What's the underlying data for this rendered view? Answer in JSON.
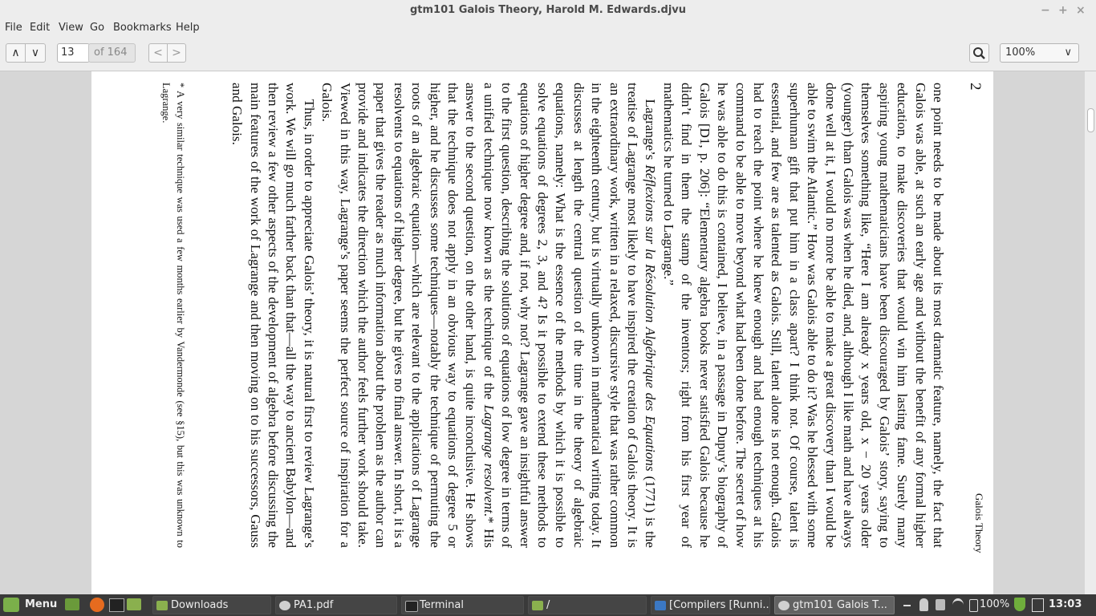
{
  "window": {
    "title": "gtm101  Galois Theory, Harold M. Edwards.djvu",
    "minimize": "−",
    "maximize": "+",
    "close": "×"
  },
  "menu": [
    "File",
    "Edit",
    "View",
    "Go",
    "Bookmarks",
    "Help"
  ],
  "toolbar": {
    "page_up": "∧",
    "page_down": "∨",
    "page_input": "13",
    "page_total": "of 164",
    "back": "<",
    "forward": ">",
    "search_icon": "search-icon",
    "zoom": "100%",
    "zoom_arrow": "∨"
  },
  "page": {
    "number": "2",
    "running_head": "Galois Theory",
    "p1": "one point needs to be made about its most dramatic feature, namely, the fact that Galois was able, at such an early age and without the benefit of any formal higher education, to make discoveries that would win him lasting fame. Surely many aspiring young mathematicians have been discouraged by Galois’ story, saying to themselves something like, “Here I am already x years old, x − 20 years older (younger) than Galois was when he died, and, although I like math and have always done well at it, I would no more be able to make a great discovery than I would be able to swim the Atlantic.” How was Galois able to do it? Was he blessed with some superhuman gift that put him in a class apart? I think not. Of course, talent is essential, and few are as talented as Galois. Still, talent alone is not enough. Galois had to reach the point where he knew enough and had enough techniques at his command to be able to move beyond what had been done before. The secret of how he was able to do this is contained, I believe, in a passage in Dupuy’s biography of Galois [D1, p. 206]: “Elementary algebra books never satisfied Galois because he didn’t find in them the stamp of the inventors; right from his first year of mathematics he turned to Lagrange.”",
    "p2_start": "Lagrange’s ",
    "p2_italic": "Réflexions sur la Résolution Algébrique des Equations",
    "p2_mid": " (1771) is the treatise of Lagrange most likely to have inspired the creation of Galois theory. It is an extraordinary work, written in a relaxed, discursive style that was rather common in the eighteenth century, but is virtually unknown in mathematical writing today. It discusses at length the central question of the time in the theory of algebraic equations, namely: What is the essence of the methods by which it is possible to solve equations of degrees 2, 3, and 4? Is it possible to extend these methods to equations of higher degree and, if not, why not? Lagrange gave an insightful answer to the first question, describing the solutions of equations of low degree in terms of a unified technique now known as the technique of the ",
    "p2_italic2": "Lagrange resolvent",
    "p2_end": ".* His answer to the second question, on the other hand, is quite inconclusive. He shows that the technique does not apply in an obvious way to equations of degree 5 or higher, and he discusses some techniques—notably the technique of permuting the roots of an algebraic equation—which are relevant to the applications of Lagrange resolvents to equations of higher degree, but he gives no final answer. In short, it is a paper that gives the reader as much information about the problem as the author can provide and indicates the direction which the author feels further work should take. Viewed in this way, Lagrange’s paper seems the perfect source of inspiration for a Galois.",
    "p3": "Thus, in order to appreciate Galois’ theory, it is natural first to review Lagrange’s work. We will go much farther back than that—all the way to ancient Babylon—and then review a few other aspects of the development of algebra before discussing the main features of the work of Lagrange and then moving on to his successors, Gauss and Galois.",
    "footnote": "* A very similar technique was used a few months earlier by Vandermonde (see §15), but this was unknown to Lagrange."
  },
  "taskbar": {
    "menu": "Menu",
    "tasks": [
      "Downloads",
      "PA1.pdf",
      "Terminal",
      "/",
      "[Compilers [Runni...",
      "gtm101  Galois T..."
    ],
    "battery": "100%",
    "clock": "13:03"
  },
  "colors": {
    "chrome": "#ededed",
    "document_bg": "#d6d6d6",
    "taskbar": "#3a3a3a",
    "active_task": "#626262"
  }
}
